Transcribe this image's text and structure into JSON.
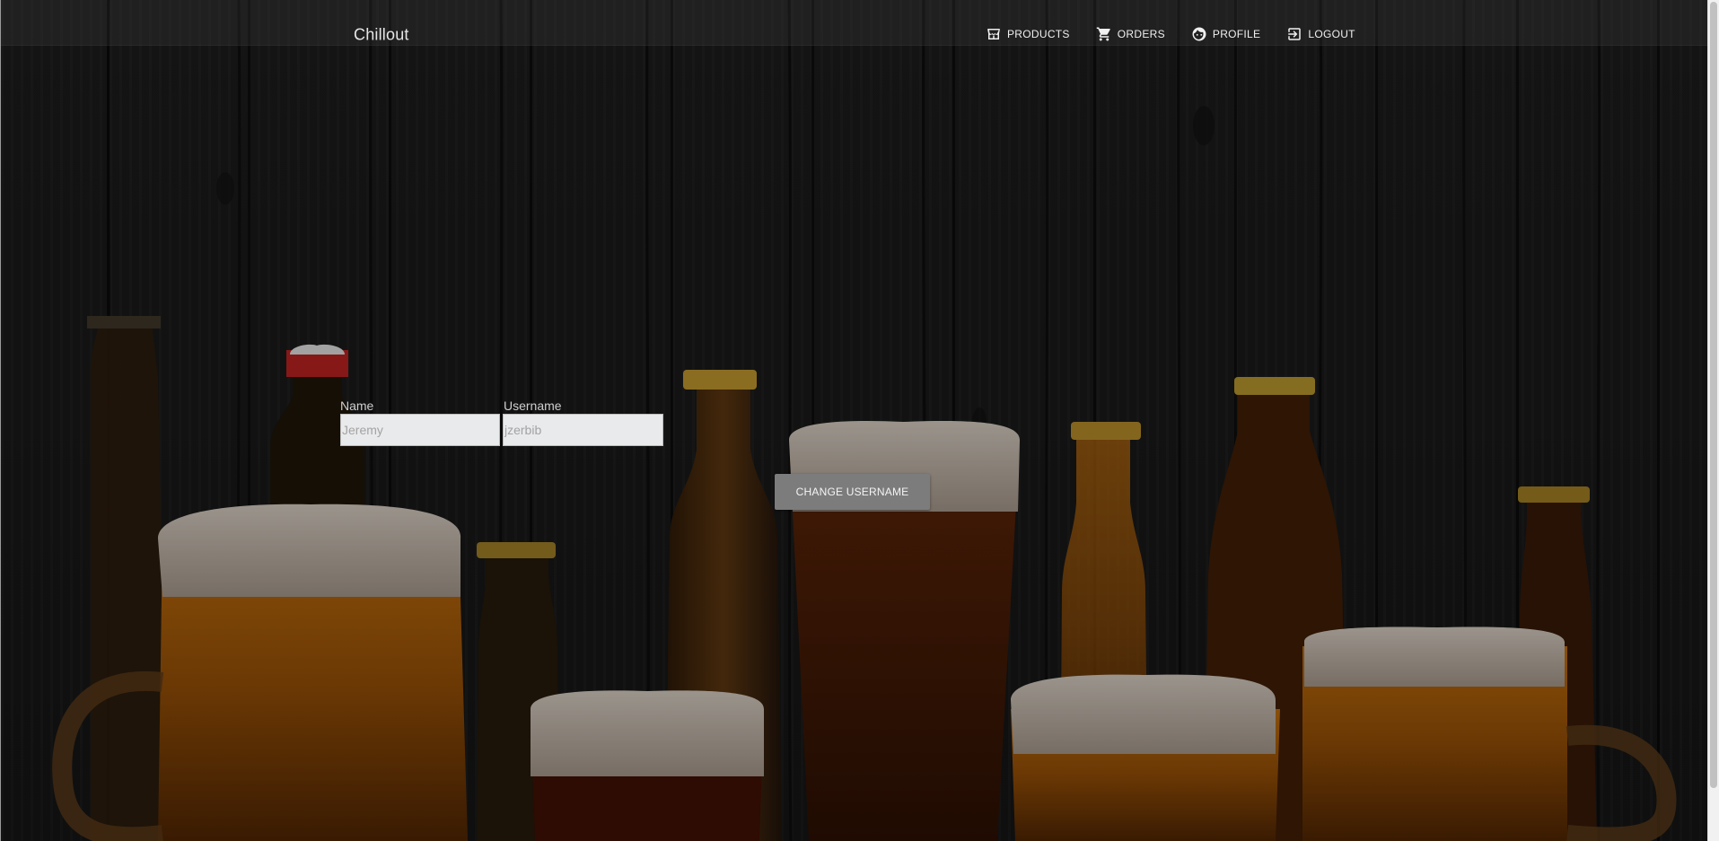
{
  "app": {
    "brand": "Chillout"
  },
  "nav": {
    "items": [
      {
        "label": "PRODUCTS",
        "icon": "store-icon"
      },
      {
        "label": "ORDERS",
        "icon": "cart-icon"
      },
      {
        "label": "PROFILE",
        "icon": "face-icon"
      },
      {
        "label": "LOGOUT",
        "icon": "logout-icon"
      }
    ]
  },
  "profile_form": {
    "name_label": "Name",
    "name_placeholder": "Jeremy",
    "username_label": "Username",
    "username_placeholder": "jzerbib",
    "change_button": "CHANGE USERNAME"
  },
  "colors": {
    "background": "#141414",
    "button": "#7c7c7c",
    "input_bg": "#e9eaec"
  }
}
